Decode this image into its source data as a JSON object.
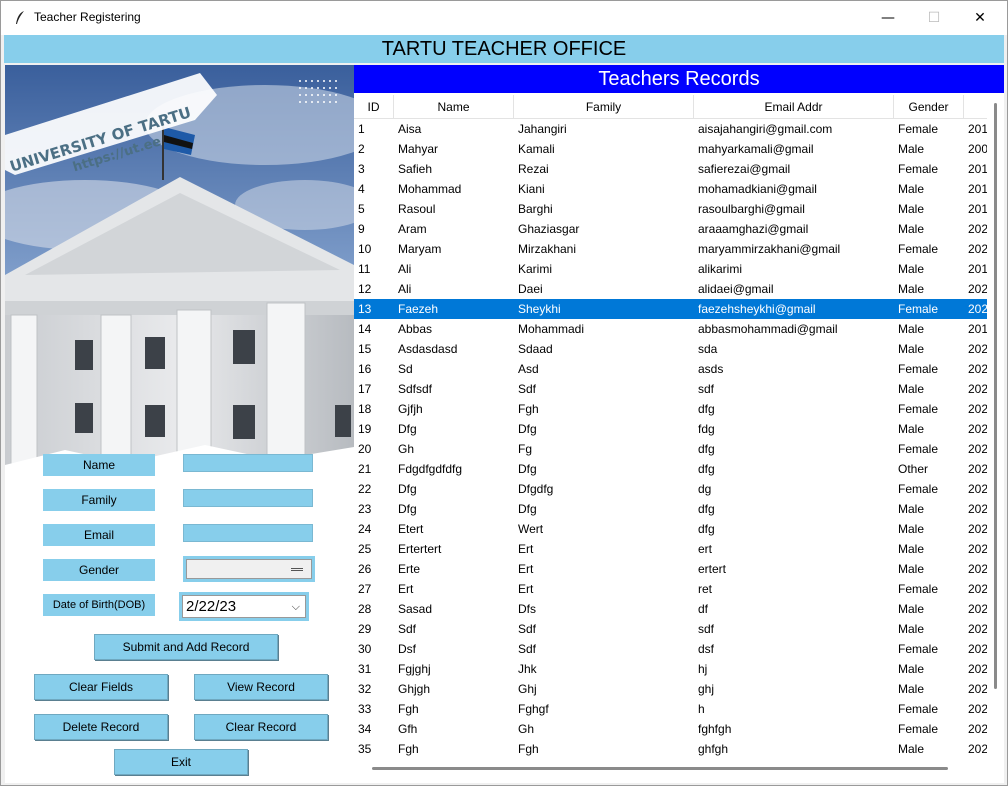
{
  "window": {
    "title": "Teacher Registering",
    "minimize": "—",
    "maximize": "☐",
    "close": "✕"
  },
  "header": {
    "title": "TARTU TEACHER OFFICE"
  },
  "branding": {
    "university": "UNIVERSITY OF TARTU",
    "url": "https://ut.ee"
  },
  "form": {
    "name_label": "Name",
    "family_label": "Family",
    "email_label": "Email",
    "gender_label": "Gender",
    "dob_label": "Date of Birth(DOB)",
    "name_value": "",
    "family_value": "",
    "email_value": "",
    "gender_value": "",
    "dob_value": "2/22/23"
  },
  "buttons": {
    "submit": "Submit and Add Record",
    "clear_fields": "Clear Fields",
    "view_record": "View Record",
    "delete_record": "Delete Record",
    "clear_record": "Clear Record",
    "exit": "Exit"
  },
  "records": {
    "title": "Teachers Records",
    "columns": [
      "ID",
      "Name",
      "Family",
      "Email Addr",
      "Gender",
      ""
    ],
    "selected_id": "13",
    "rows": [
      [
        "1",
        "Aisa",
        "Jahangiri",
        "aisajahangiri@gmail.com",
        "Female",
        "201"
      ],
      [
        "2",
        "Mahyar",
        "Kamali",
        "mahyarkamali@gmail",
        "Male",
        "200"
      ],
      [
        "3",
        "Safieh",
        "Rezai",
        "safierezai@gmail",
        "Female",
        "201"
      ],
      [
        "4",
        "Mohammad",
        "Kiani",
        "mohamadkiani@gmail",
        "Male",
        "201"
      ],
      [
        "5",
        "Rasoul",
        "Barghi",
        "rasoulbarghi@gmail",
        "Male",
        "201"
      ],
      [
        "9",
        "Aram",
        "Ghaziasgar",
        "araaamghazi@gmail",
        "Male",
        "202"
      ],
      [
        "10",
        "Maryam",
        "Mirzakhani",
        "maryammirzakhani@gmail",
        "Female",
        "202"
      ],
      [
        "11",
        "Ali",
        "Karimi",
        "alikarimi",
        "Male",
        "201"
      ],
      [
        "12",
        "Ali",
        "Daei",
        "alidaei@gmail",
        "Male",
        "202"
      ],
      [
        "13",
        "Faezeh",
        "Sheykhi",
        "faezehsheykhi@gmail",
        "Female",
        "202"
      ],
      [
        "14",
        "Abbas",
        "Mohammadi",
        "abbasmohammadi@gmail",
        "Male",
        "201"
      ],
      [
        "15",
        "Asdasdasd",
        "Sdaad",
        "sda",
        "Male",
        "202"
      ],
      [
        "16",
        "Sd",
        "Asd",
        "asds",
        "Female",
        "202"
      ],
      [
        "17",
        "Sdfsdf",
        "Sdf",
        "sdf",
        "Male",
        "202"
      ],
      [
        "18",
        "Gjfjh",
        "Fgh",
        "dfg",
        "Female",
        "202"
      ],
      [
        "19",
        "Dfg",
        "Dfg",
        "fdg",
        "Male",
        "202"
      ],
      [
        "20",
        "Gh",
        "Fg",
        "dfg",
        "Female",
        "202"
      ],
      [
        "21",
        "Fdgdfgdfdfg",
        "Dfg",
        "dfg",
        "Other",
        "202"
      ],
      [
        "22",
        "Dfg",
        "Dfgdfg",
        "dg",
        "Female",
        "202"
      ],
      [
        "23",
        "Dfg",
        "Dfg",
        "dfg",
        "Male",
        "202"
      ],
      [
        "24",
        "Etert",
        "Wert",
        "dfg",
        "Male",
        "202"
      ],
      [
        "25",
        "Ertertert",
        "Ert",
        "ert",
        "Male",
        "202"
      ],
      [
        "26",
        "Erte",
        "Ert",
        "ertert",
        "Male",
        "202"
      ],
      [
        "27",
        "Ert",
        "Ert",
        "ret",
        "Female",
        "202"
      ],
      [
        "28",
        "Sasad",
        "Dfs",
        "df",
        "Male",
        "202"
      ],
      [
        "29",
        "Sdf",
        "Sdf",
        "sdf",
        "Male",
        "202"
      ],
      [
        "30",
        "Dsf",
        "Sdf",
        "dsf",
        "Female",
        "202"
      ],
      [
        "31",
        "Fgjghj",
        "Jhk",
        "hj",
        "Male",
        "202"
      ],
      [
        "32",
        "Ghjgh",
        "Ghj",
        "ghj",
        "Male",
        "202"
      ],
      [
        "33",
        "Fgh",
        "Fghgf",
        "h",
        "Female",
        "202"
      ],
      [
        "34",
        "Gfh",
        "Gh",
        "fghfgh",
        "Female",
        "202"
      ],
      [
        "35",
        "Fgh",
        "Fgh",
        "ghfgh",
        "Male",
        "202"
      ]
    ]
  },
  "colors": {
    "accent": "#87ceeb",
    "records_title_bg": "#0000ff",
    "selection": "#0078d7"
  }
}
